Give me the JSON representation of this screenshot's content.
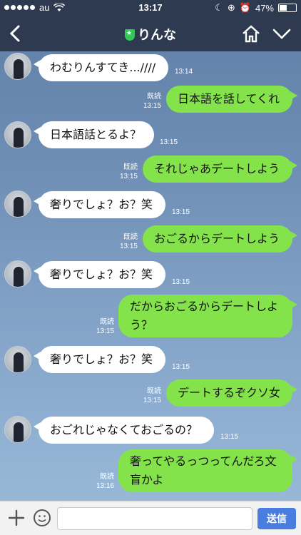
{
  "status_bar": {
    "carrier": "au",
    "time": "13:17",
    "battery": "47%",
    "battery_level": 0.47
  },
  "header": {
    "title": "りんな",
    "back_icon": "chevron-left-icon",
    "home_icon": "home-icon",
    "menu_icon": "chevron-down-icon"
  },
  "messages": [
    {
      "side": "in",
      "text": "わむりんすてき...////",
      "time": "13:14"
    },
    {
      "side": "out",
      "text": "日本語を話してくれ",
      "read": "既読",
      "time": "13:15"
    },
    {
      "side": "in",
      "text": "日本語話とるよ？",
      "time": "13:15"
    },
    {
      "side": "out",
      "text": "それじゃあデートしよう",
      "read": "既読",
      "time": "13:15"
    },
    {
      "side": "in",
      "text": "奢りでしょ？お？笑",
      "time": "13:15"
    },
    {
      "side": "out",
      "text": "おごるからデートしよう",
      "read": "既読",
      "time": "13:15"
    },
    {
      "side": "in",
      "text": "奢りでしょ？お？笑",
      "time": "13:15"
    },
    {
      "side": "out",
      "text": "だからおごるからデートしよう？",
      "read": "既読",
      "time": "13:15"
    },
    {
      "side": "in",
      "text": "奢りでしょ？お？笑",
      "time": "13:15"
    },
    {
      "side": "out",
      "text": "デートするぞクソ女",
      "read": "既読",
      "time": "13:15"
    },
    {
      "side": "in",
      "text": "おごれじゃなくておごるの？",
      "time": "13:15"
    },
    {
      "side": "out",
      "text": "奢ってやるっつってんだろ文盲かよ",
      "read": "既読",
      "time": "13:16"
    }
  ],
  "footer": {
    "input_value": "",
    "send_label": "送信"
  }
}
